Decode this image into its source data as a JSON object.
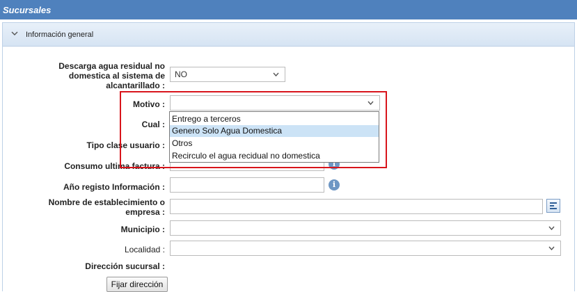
{
  "header": {
    "title": "Sucursales"
  },
  "panel": {
    "title": "Información general",
    "chevron": "chevron-down-icon"
  },
  "fields": {
    "descarga": {
      "label_lines": [
        "Descarga agua residual no",
        "domestica al sistema de",
        "alcantarillado :"
      ],
      "value": "NO"
    },
    "motivo": {
      "label": "Motivo :",
      "value": ""
    },
    "cual": {
      "label": "Cual :"
    },
    "tipo_clase": {
      "label": "Tipo clase usuario :"
    },
    "consumo": {
      "label": "Consumo ultima factura :"
    },
    "anio": {
      "label": "Año registo Información :"
    },
    "nombre": {
      "label_lines": [
        "Nombre de establecimiento o",
        "empresa :"
      ]
    },
    "municipio": {
      "label": "Municipio :",
      "value": ""
    },
    "localidad": {
      "label": "Localidad :",
      "value": ""
    },
    "direccion": {
      "label": "Dirección sucursal :"
    }
  },
  "dropdown": {
    "options": [
      "Entrego a terceros",
      "Genero Solo Agua Domestica",
      "Otros",
      "Recirculo el agua recidual no domestica"
    ],
    "highlighted": "Genero Solo Agua Domestica"
  },
  "buttons": {
    "fijar": "Fijar dirección"
  },
  "colors": {
    "header": "#4f81bd",
    "highlight_box": "#d8141b",
    "info_icon": "#6e97c4"
  }
}
